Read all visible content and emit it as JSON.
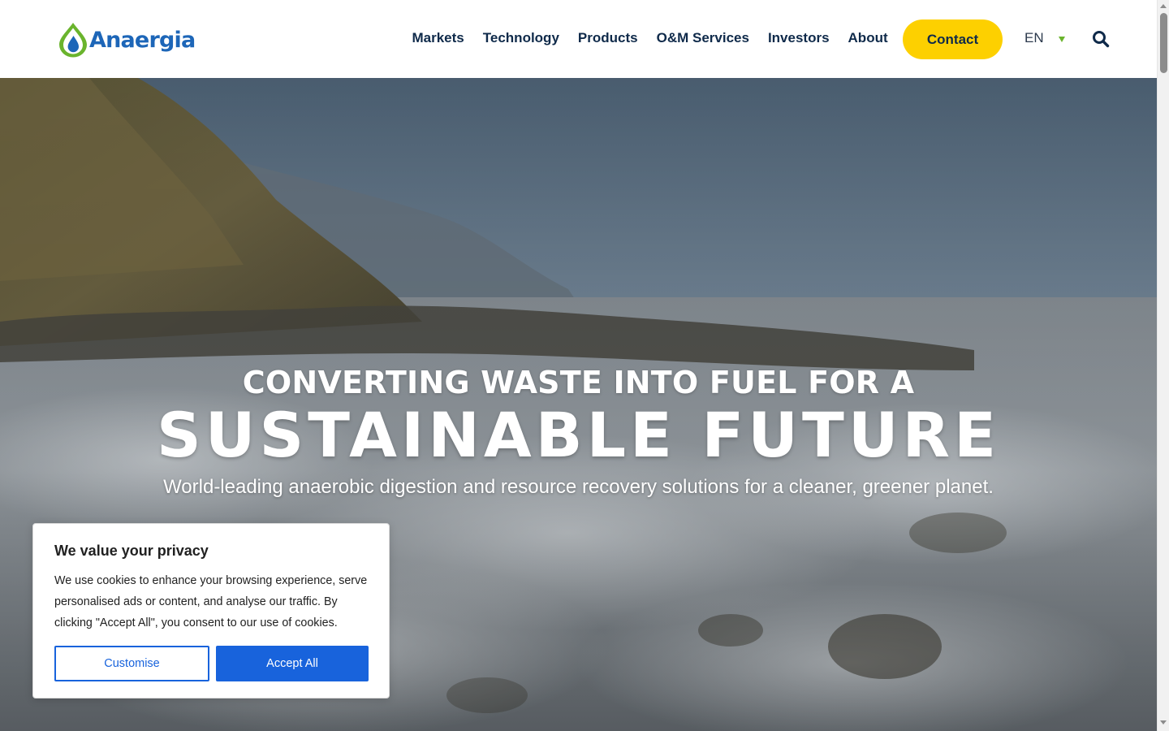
{
  "header": {
    "logo_text": "Anaergia",
    "nav": [
      {
        "label": "Markets"
      },
      {
        "label": "Technology"
      },
      {
        "label": "Products"
      },
      {
        "label": "O&M Services"
      },
      {
        "label": "Investors"
      },
      {
        "label": "About"
      }
    ],
    "contact_label": "Contact",
    "language": "EN",
    "search_icon": "search-icon"
  },
  "hero": {
    "title_small": "CONVERTING WASTE INTO FUEL FOR A",
    "title_big": "SUSTAINABLE FUTURE",
    "subtitle": "World-leading anaerobic digestion and resource recovery solutions for a cleaner, greener planet."
  },
  "cookie_banner": {
    "title": "We value your privacy",
    "text": "We use cookies to enhance your browsing experience, serve personalised ads or content, and analyse our traffic. By clicking \"Accept All\", you consent to our use of cookies.",
    "customise_label": "Customise",
    "accept_label": "Accept All"
  },
  "colors": {
    "brand_blue": "#1d66b8",
    "brand_green": "#6ab42d",
    "nav_text": "#0f2a4a",
    "contact_yellow": "#fdd000",
    "cookie_button_blue": "#1863dc"
  }
}
